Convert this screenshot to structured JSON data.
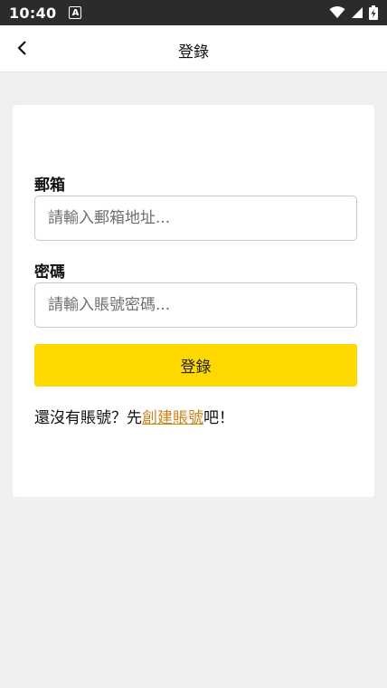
{
  "status_bar": {
    "time": "10:40",
    "notification_icon": "a-letter-icon",
    "icons": [
      "wifi-icon",
      "signal-icon",
      "battery-charging-icon"
    ]
  },
  "nav": {
    "title": "登錄",
    "back_icon": "chevron-left-icon"
  },
  "form": {
    "email_label": "郵箱",
    "email_placeholder": "請輸入郵箱地址...",
    "password_label": "密碼",
    "password_placeholder": "請輸入賬號密碼...",
    "login_button": "登錄",
    "signup_prefix": "還沒有賬號？先",
    "signup_link": "創建賬號",
    "signup_suffix": "吧！"
  },
  "colors": {
    "accent": "#ffd800",
    "link": "#c8841a",
    "background": "#efefef",
    "status_bar": "#2b2b2b"
  }
}
